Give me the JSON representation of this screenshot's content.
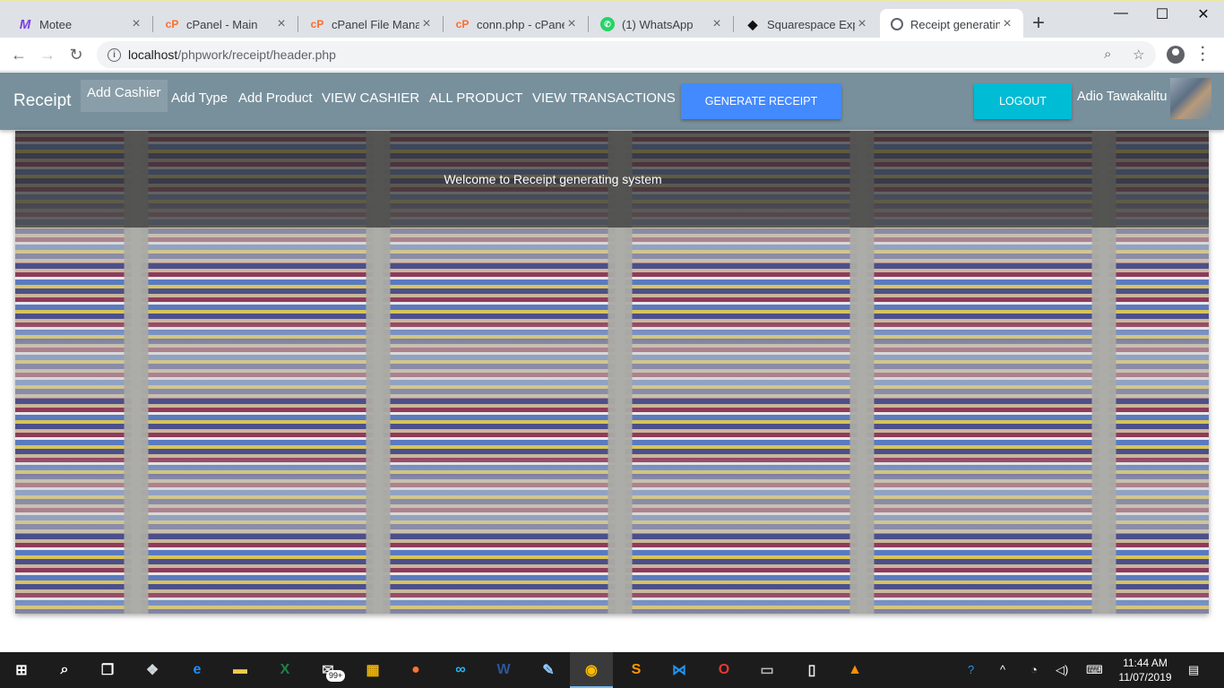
{
  "browser": {
    "tabs": [
      {
        "title": "Motee",
        "favicon": "motee-icon",
        "active": false
      },
      {
        "title": "cPanel - Main",
        "favicon": "cpanel-icon",
        "active": false
      },
      {
        "title": "cPanel File Manag",
        "favicon": "cpanel-icon",
        "active": false
      },
      {
        "title": "conn.php - cPanel",
        "favicon": "cpanel-icon",
        "active": false
      },
      {
        "title": "(1) WhatsApp",
        "favicon": "whatsapp-icon",
        "active": false
      },
      {
        "title": "Squarespace Expe",
        "favicon": "squarespace-icon",
        "active": false
      },
      {
        "title": "Receipt generating",
        "favicon": "globe-icon",
        "active": true
      }
    ],
    "new_tab_glyph": "+",
    "url_host": "localhost",
    "url_path": "/phpwork/receipt/header.php"
  },
  "app": {
    "brand": "Receipt",
    "nav": [
      {
        "label": "Add Cashier",
        "active": true
      },
      {
        "label": "Add Type",
        "active": false
      },
      {
        "label": "Add Product",
        "active": false
      },
      {
        "label": "VIEW CASHIER",
        "active": false
      },
      {
        "label": "ALL PRODUCT",
        "active": false
      },
      {
        "label": "VIEW TRANSACTIONS",
        "active": false
      }
    ],
    "generate_button": "GENERATE RECEIPT",
    "logout_button": "LOGOUT",
    "user_name": "Adio Tawakalitu",
    "colors": {
      "navbar": "#78909c",
      "generate": "#448aff",
      "logout": "#00bcd4"
    }
  },
  "main": {
    "welcome": "Welcome to Receipt generating system"
  },
  "taskbar": {
    "badge": "99+",
    "time": "11:44 AM",
    "date": "11/07/2019"
  }
}
